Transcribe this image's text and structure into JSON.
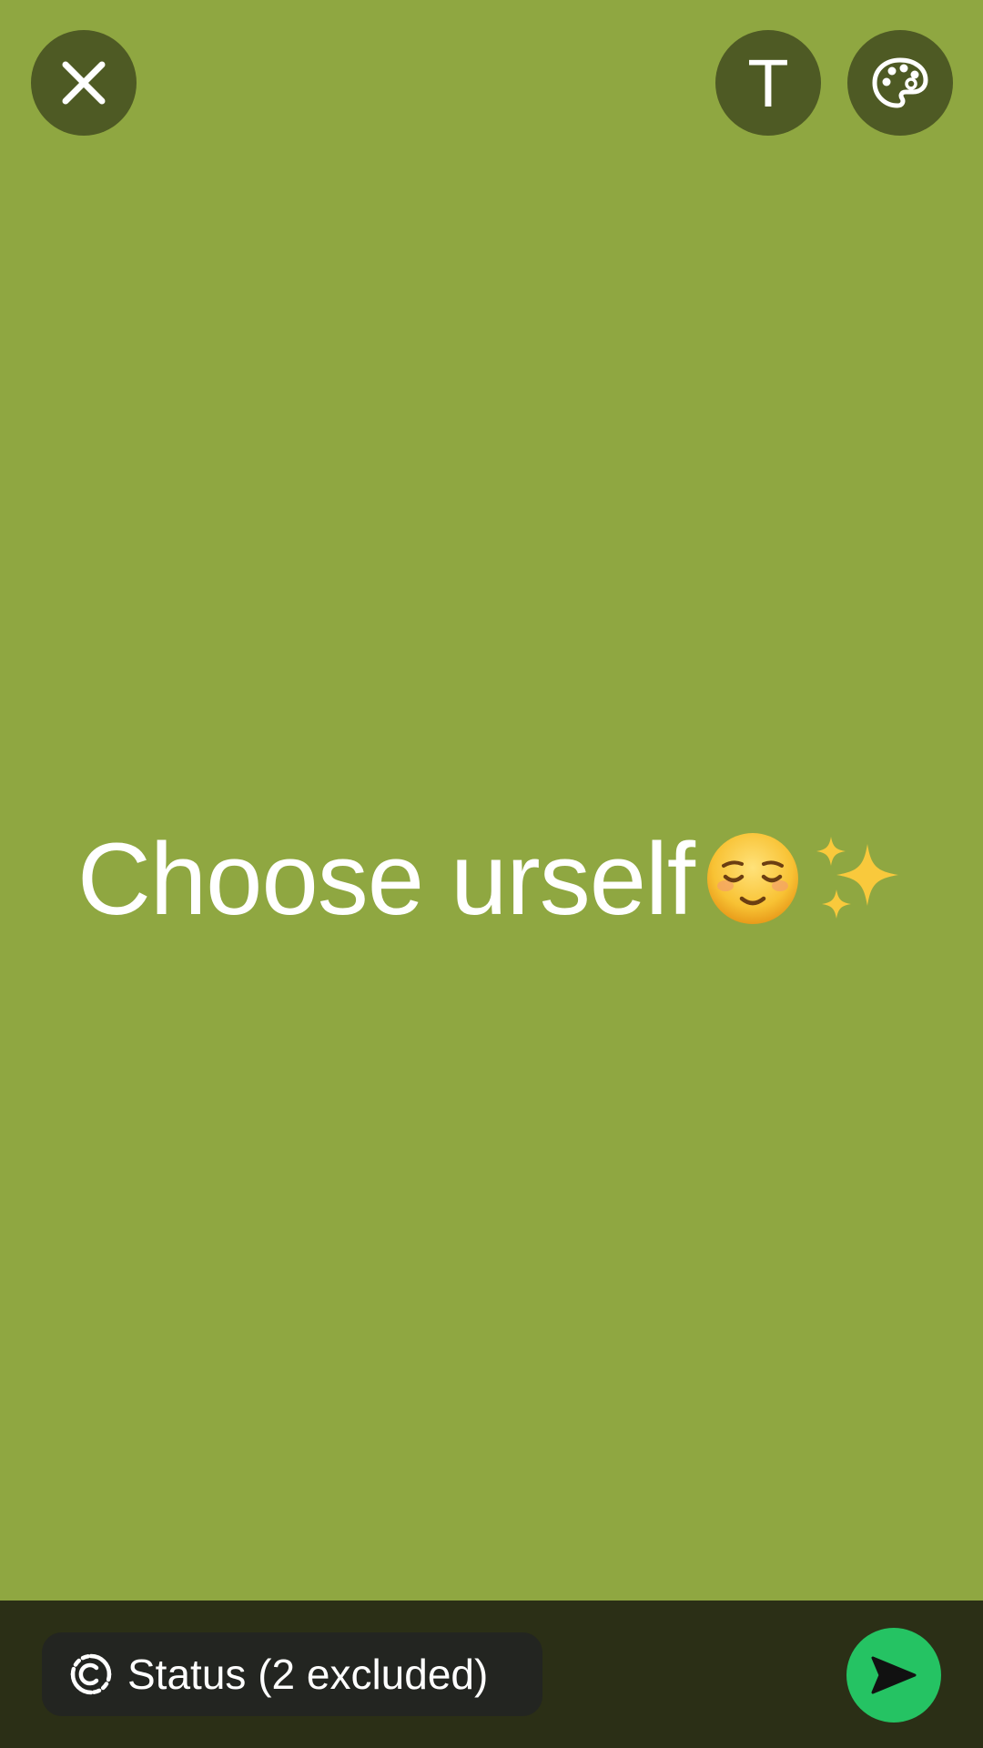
{
  "editor": {
    "background_color": "#8fa741",
    "status_text": "Choose urself",
    "emojis": [
      "relieved-face-emoji",
      "sparkles-emoji"
    ]
  },
  "toolbar": {
    "close_icon": "close-icon",
    "text_button_glyph": "T",
    "palette_icon": "palette-icon"
  },
  "bottom_bar": {
    "audience_icon": "status-ring-icon",
    "audience_label": "Status (2 excluded)",
    "send_icon": "send-icon",
    "send_color": "#25c363"
  }
}
